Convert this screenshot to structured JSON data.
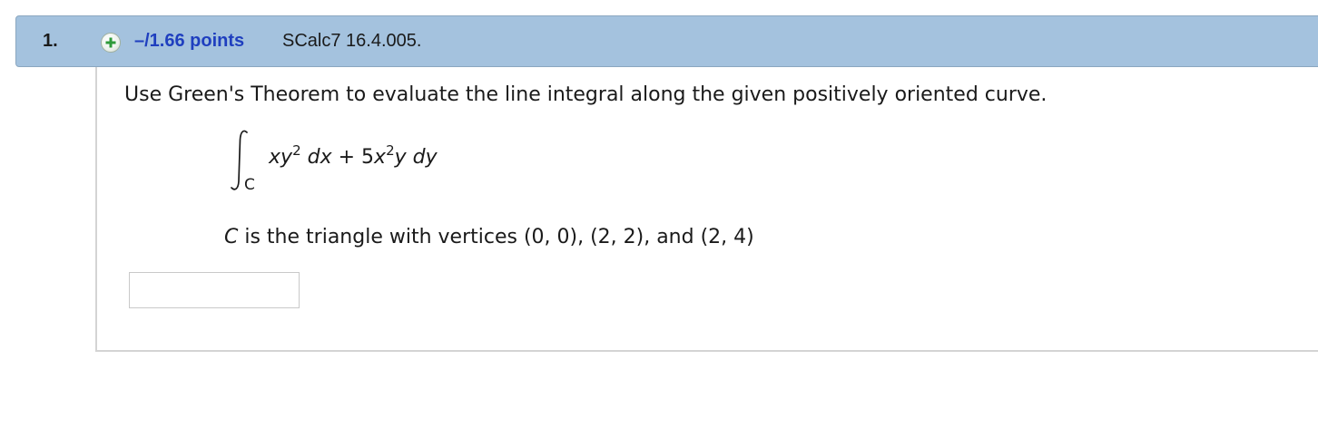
{
  "header": {
    "number": "1.",
    "points": "–/1.66 points",
    "source": "SCalc7 16.4.005."
  },
  "question": {
    "prompt": "Use Green's Theorem to evaluate the line integral along the given positively oriented curve.",
    "integral": {
      "subscript": "C",
      "x1": "x",
      "y1": "y",
      "exp1": "2",
      "dx": "dx",
      "op": "+",
      "coef": "5",
      "x2": "x",
      "exp2": "2",
      "y2": "y",
      "dy": "dy"
    },
    "curve_var": "C",
    "curve_text": " is the triangle with vertices (0, 0), (2, 2), and (2, 4)",
    "answer": {
      "value": "",
      "placeholder": ""
    }
  },
  "icons": {
    "expand": "plus-circle-icon"
  },
  "colors": {
    "header_bg": "#a4c2de",
    "points_text": "#1f3fbf",
    "plus_icon": "#2e9a3a"
  }
}
